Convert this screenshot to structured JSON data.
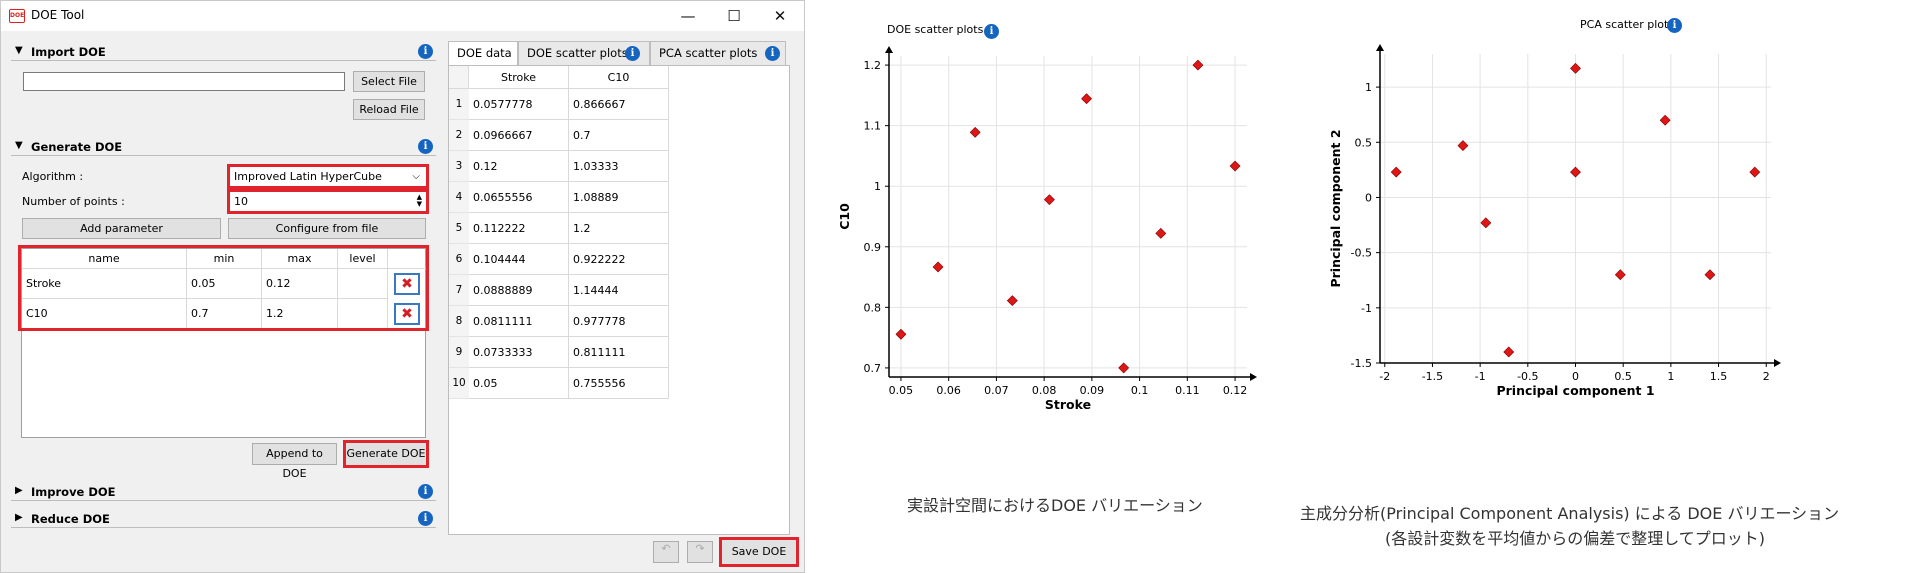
{
  "window": {
    "title": "DOE Tool",
    "app_icon_text": "DOE",
    "controls": {
      "minimize": "—",
      "maximize": "☐",
      "close": "✕"
    }
  },
  "import_doe": {
    "header": "Import DOE",
    "file_path_value": "",
    "select_file_label": "Select File",
    "reload_file_label": "Reload File"
  },
  "generate_doe": {
    "header": "Generate DOE",
    "algorithm_label": "Algorithm :",
    "algorithm_value": "Improved Latin HyperCube",
    "num_points_label": "Number of points :",
    "num_points_value": "10",
    "add_parameter_label": "Add parameter",
    "configure_label": "Configure from file",
    "table_headers": [
      "name",
      "min",
      "max",
      "level"
    ],
    "parameters": [
      {
        "name": "Stroke",
        "min": "0.05",
        "max": "0.12",
        "level": ""
      },
      {
        "name": "C10",
        "min": "0.7",
        "max": "1.2",
        "level": ""
      }
    ],
    "append_label": "Append to DOE",
    "generate_label": "Generate DOE"
  },
  "improve_doe": {
    "header": "Improve DOE"
  },
  "reduce_doe": {
    "header": "Reduce DOE"
  },
  "footer": {
    "save_label": "Save DOE"
  },
  "tabs": [
    "DOE data",
    "DOE scatter plots",
    "PCA scatter plots"
  ],
  "doe_table": {
    "headers": [
      "Stroke",
      "C10"
    ],
    "rows": [
      [
        "1",
        "0.0577778",
        "0.866667"
      ],
      [
        "2",
        "0.0966667",
        "0.7"
      ],
      [
        "3",
        "0.12",
        "1.03333"
      ],
      [
        "4",
        "0.0655556",
        "1.08889"
      ],
      [
        "5",
        "0.112222",
        "1.2"
      ],
      [
        "6",
        "0.104444",
        "0.922222"
      ],
      [
        "7",
        "0.0888889",
        "1.14444"
      ],
      [
        "8",
        "0.0811111",
        "0.977778"
      ],
      [
        "9",
        "0.0733333",
        "0.811111"
      ],
      [
        "10",
        "0.05",
        "0.755556"
      ]
    ]
  },
  "colors": {
    "highlight": "#e0242e",
    "info": "#1565c0",
    "marker": "#e01515"
  },
  "icons": [
    "collapse-triangle-icon",
    "expand-triangle-icon",
    "info-icon",
    "delete-x-icon",
    "undo-icon",
    "redo-icon",
    "spin-arrows-icon",
    "dropdown-chevron-icon"
  ],
  "chart_data": [
    {
      "type": "scatter",
      "title": "DOE scatter plots",
      "xlabel": "Stroke",
      "ylabel": "C10",
      "xlim": [
        0.0475,
        0.1225
      ],
      "ylim": [
        0.685,
        1.215
      ],
      "xticks": [
        "0.05",
        "0.06",
        "0.07",
        "0.08",
        "0.09",
        "0.1",
        "0.11",
        "0.12"
      ],
      "yticks": [
        "0.7",
        "0.8",
        "0.9",
        "1",
        "1.1",
        "1.2"
      ],
      "grid": true,
      "x": [
        0.0577778,
        0.0966667,
        0.12,
        0.0655556,
        0.112222,
        0.104444,
        0.0888889,
        0.0811111,
        0.0733333,
        0.05
      ],
      "y": [
        0.866667,
        0.7,
        1.03333,
        1.08889,
        1.2,
        0.922222,
        1.14444,
        0.977778,
        0.811111,
        0.755556
      ],
      "caption": "実設計空間におけるDOE バリエーション"
    },
    {
      "type": "scatter",
      "title": "PCA scatter plots",
      "xlabel": "Principal component 1",
      "ylabel": "Principal component 2",
      "xlim": [
        -2.05,
        2.05
      ],
      "ylim": [
        -1.5,
        1.3
      ],
      "xticks": [
        "-2",
        "-1.5",
        "-1",
        "-0.5",
        "0",
        "0.5",
        "1",
        "1.5",
        "2"
      ],
      "yticks": [
        "-1.5",
        "-1",
        "-0.5",
        "0",
        "0.5",
        "1"
      ],
      "grid": true,
      "x": [
        -1.88,
        -1.18,
        -0.94,
        -0.7,
        0,
        0,
        0.47,
        0.94,
        1.41,
        1.88
      ],
      "y": [
        0.23,
        0.47,
        -0.23,
        -1.4,
        1.17,
        0.23,
        -0.7,
        0.7,
        -0.7,
        0.23
      ],
      "caption": "主成分分析(Principal Component Analysis) による DOE バリエーション",
      "caption2": "(各設計変数を平均値からの偏差で整理してプロット)"
    }
  ]
}
